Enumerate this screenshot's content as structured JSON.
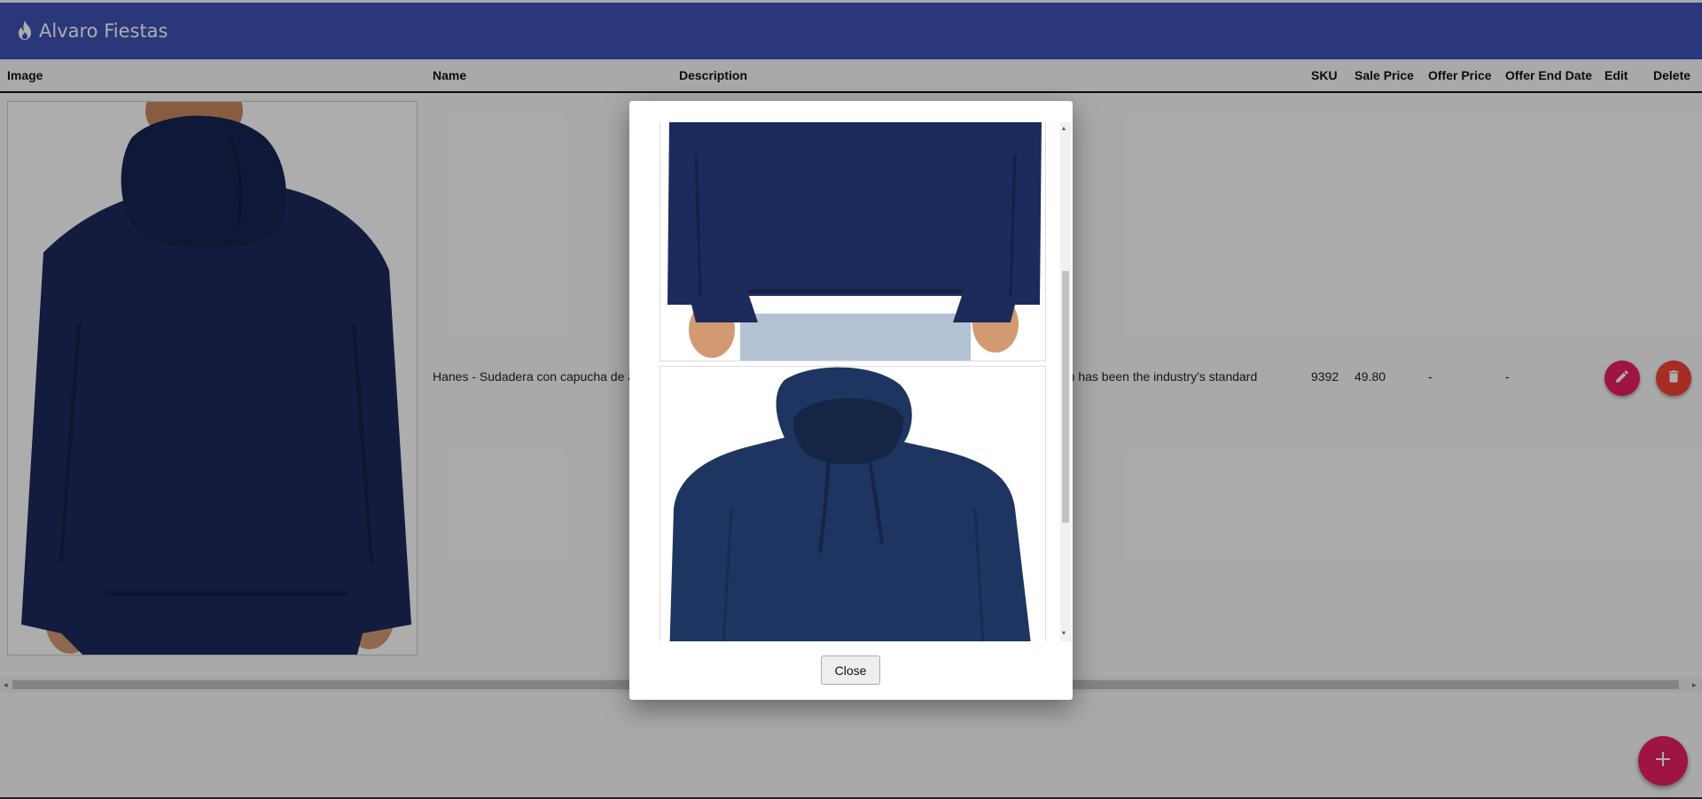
{
  "app": {
    "brand": "Alvaro Fiestas",
    "logo_icon": "flame-icon",
    "bar_color": "#3f51b5"
  },
  "table": {
    "headers": [
      "Image",
      "Name",
      "Description",
      "SKU",
      "Sale Price",
      "Offer Price",
      "Offer End Date",
      "Edit",
      "Delete"
    ],
    "rows": [
      {
        "name": "Hanes - Sudadera con capucha de a",
        "description": "um has been the industry's standard",
        "sku": "9392",
        "sale_price": "49.80",
        "offer_price": "-",
        "offer_end_date": "-",
        "edit_icon": "pencil-icon",
        "delete_icon": "trash-icon"
      }
    ]
  },
  "fab": {
    "icon": "plus-icon",
    "color": "#e91e63"
  },
  "modal": {
    "close_label": "Close"
  },
  "colors": {
    "accent": "#e91e63",
    "danger": "#f44336",
    "hoodie_navy": "#1c2a5c"
  }
}
